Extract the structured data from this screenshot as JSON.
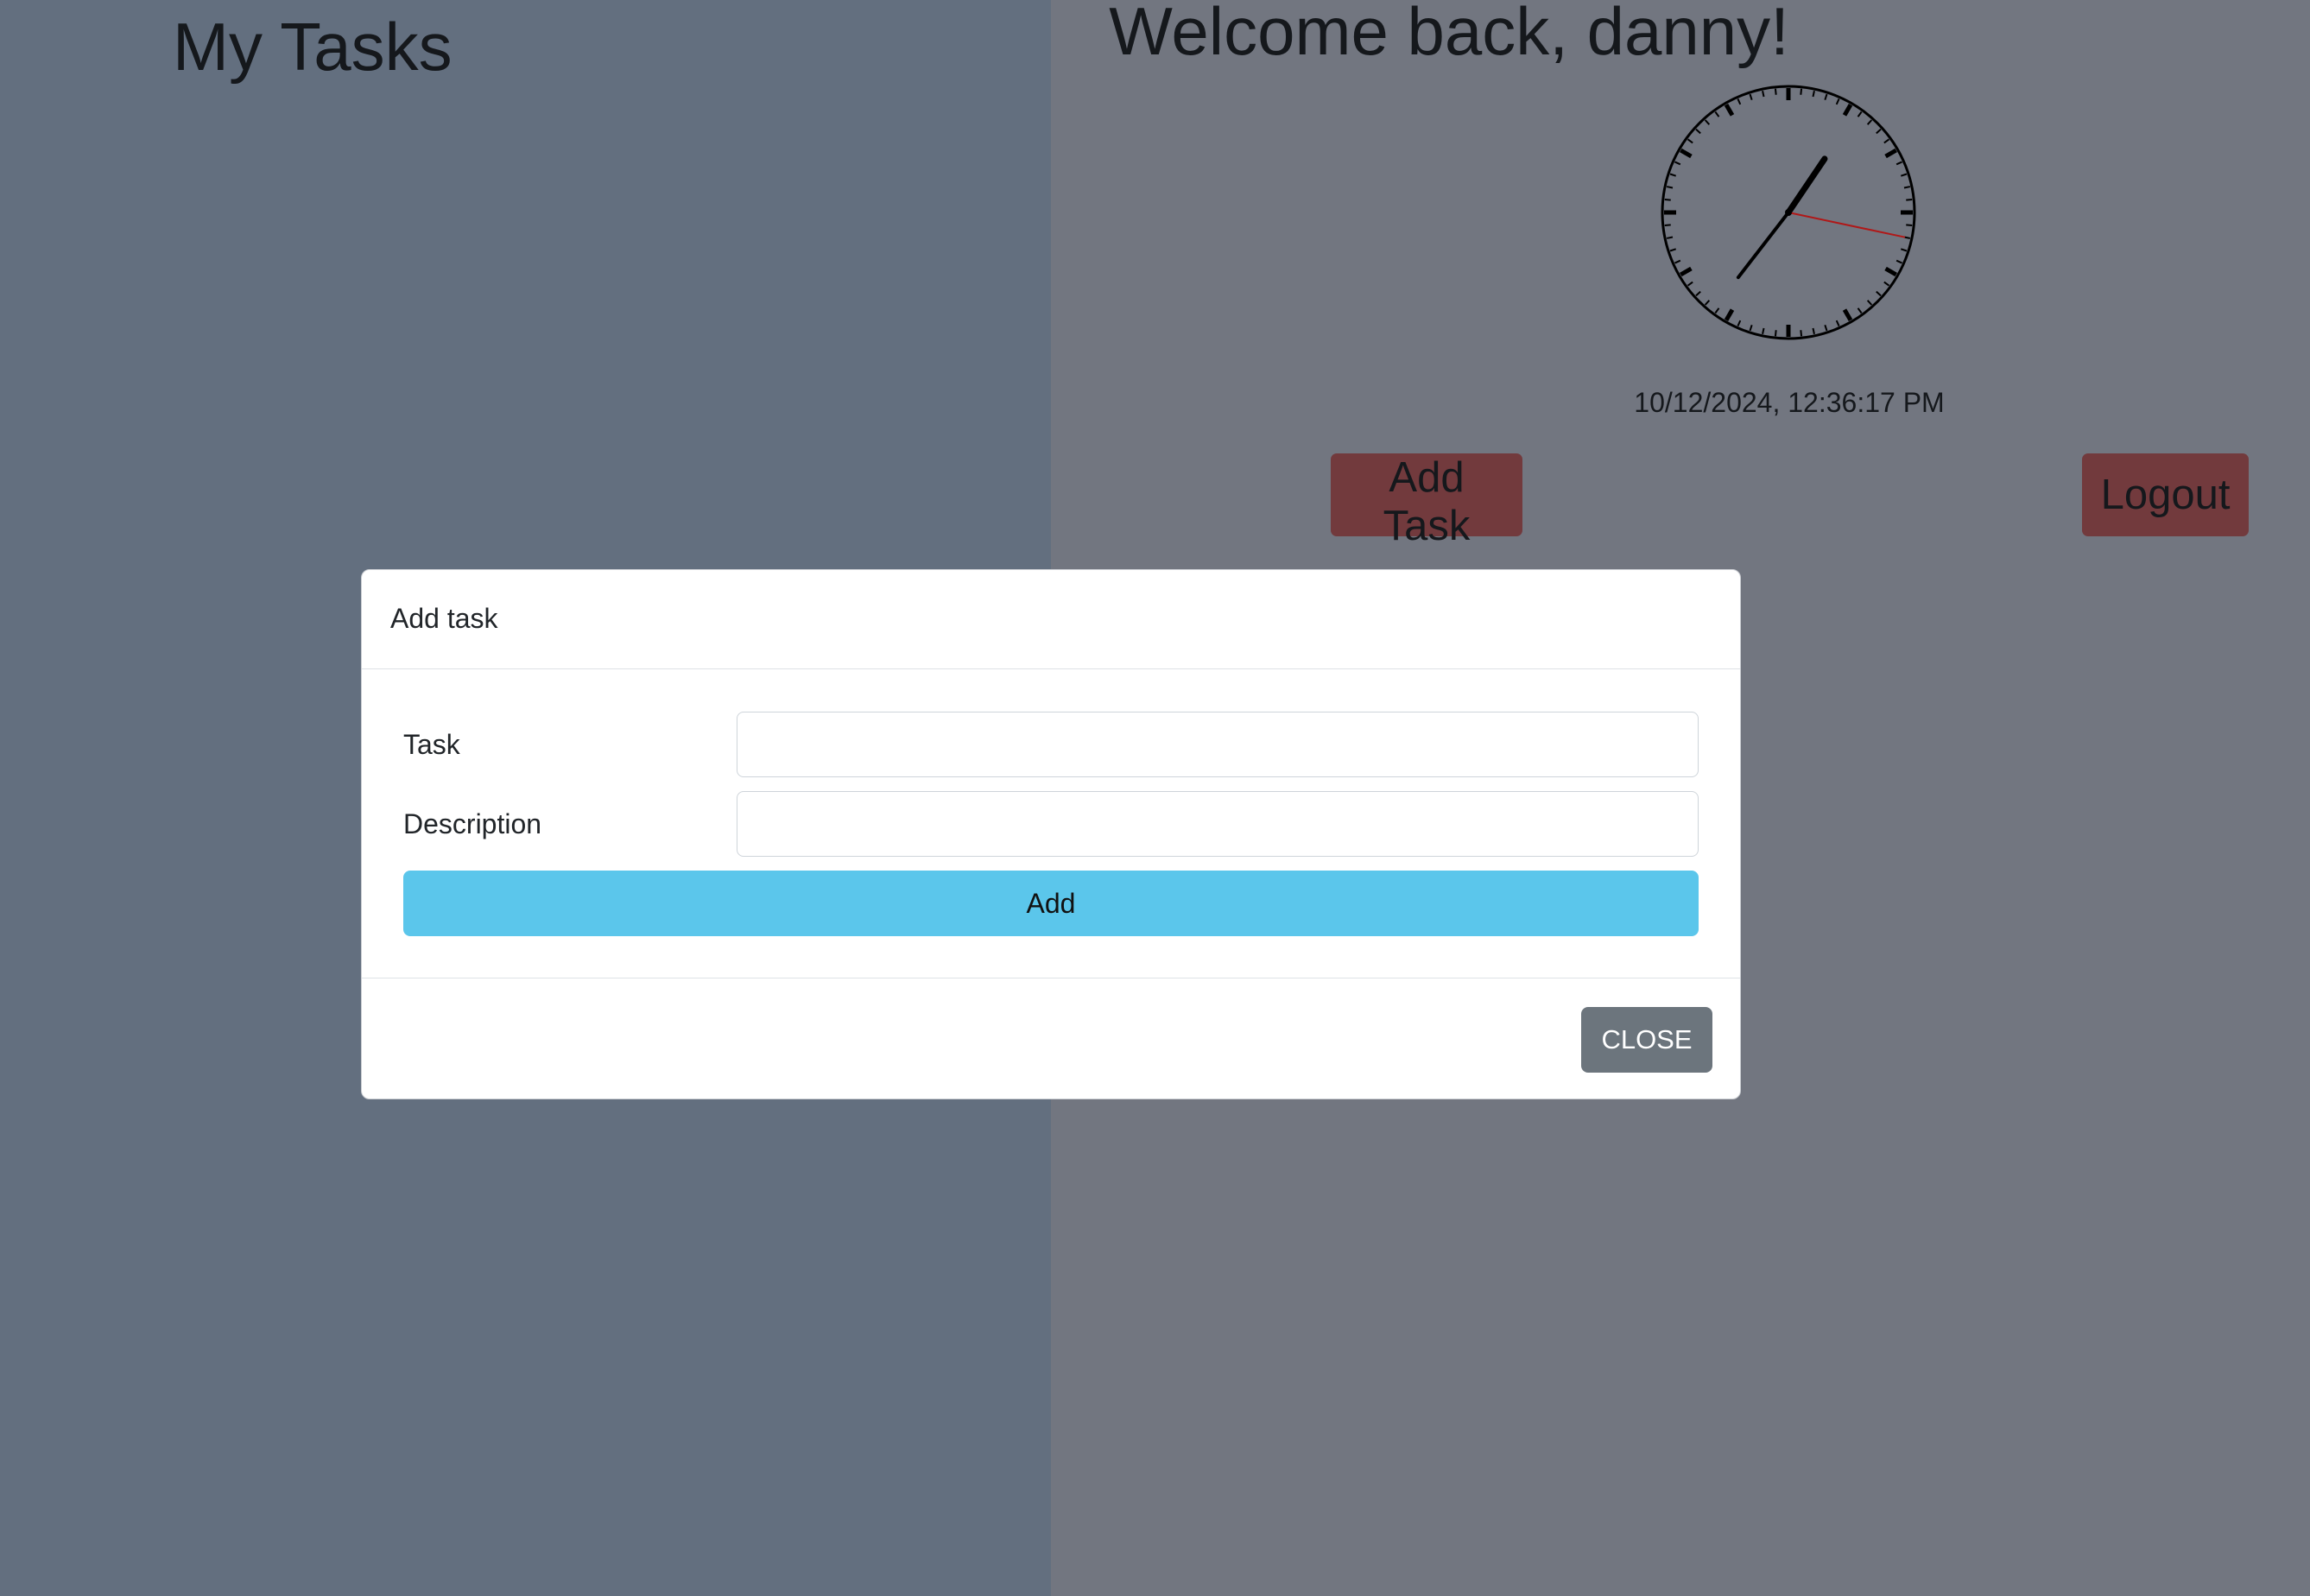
{
  "left": {
    "title": "My Tasks"
  },
  "right": {
    "welcome": "Welcome back, danny!",
    "clock": {
      "hours": 12,
      "minutes": 36,
      "seconds": 17
    },
    "datetime": "10/12/2024, 12:36:17 PM",
    "add_task_label": "Add Task",
    "logout_label": "Logout"
  },
  "modal": {
    "title": "Add task",
    "task_label": "Task",
    "task_value": "",
    "description_label": "Description",
    "description_value": "",
    "submit_label": "Add",
    "close_label": "CLOSE"
  },
  "colors": {
    "left_bg": "#636f7f",
    "right_bg": "#727680",
    "accent_red": "#723a3d",
    "submit_blue": "#5bc6eb",
    "close_gray": "#6c757d",
    "second_hand": "#b01818"
  }
}
